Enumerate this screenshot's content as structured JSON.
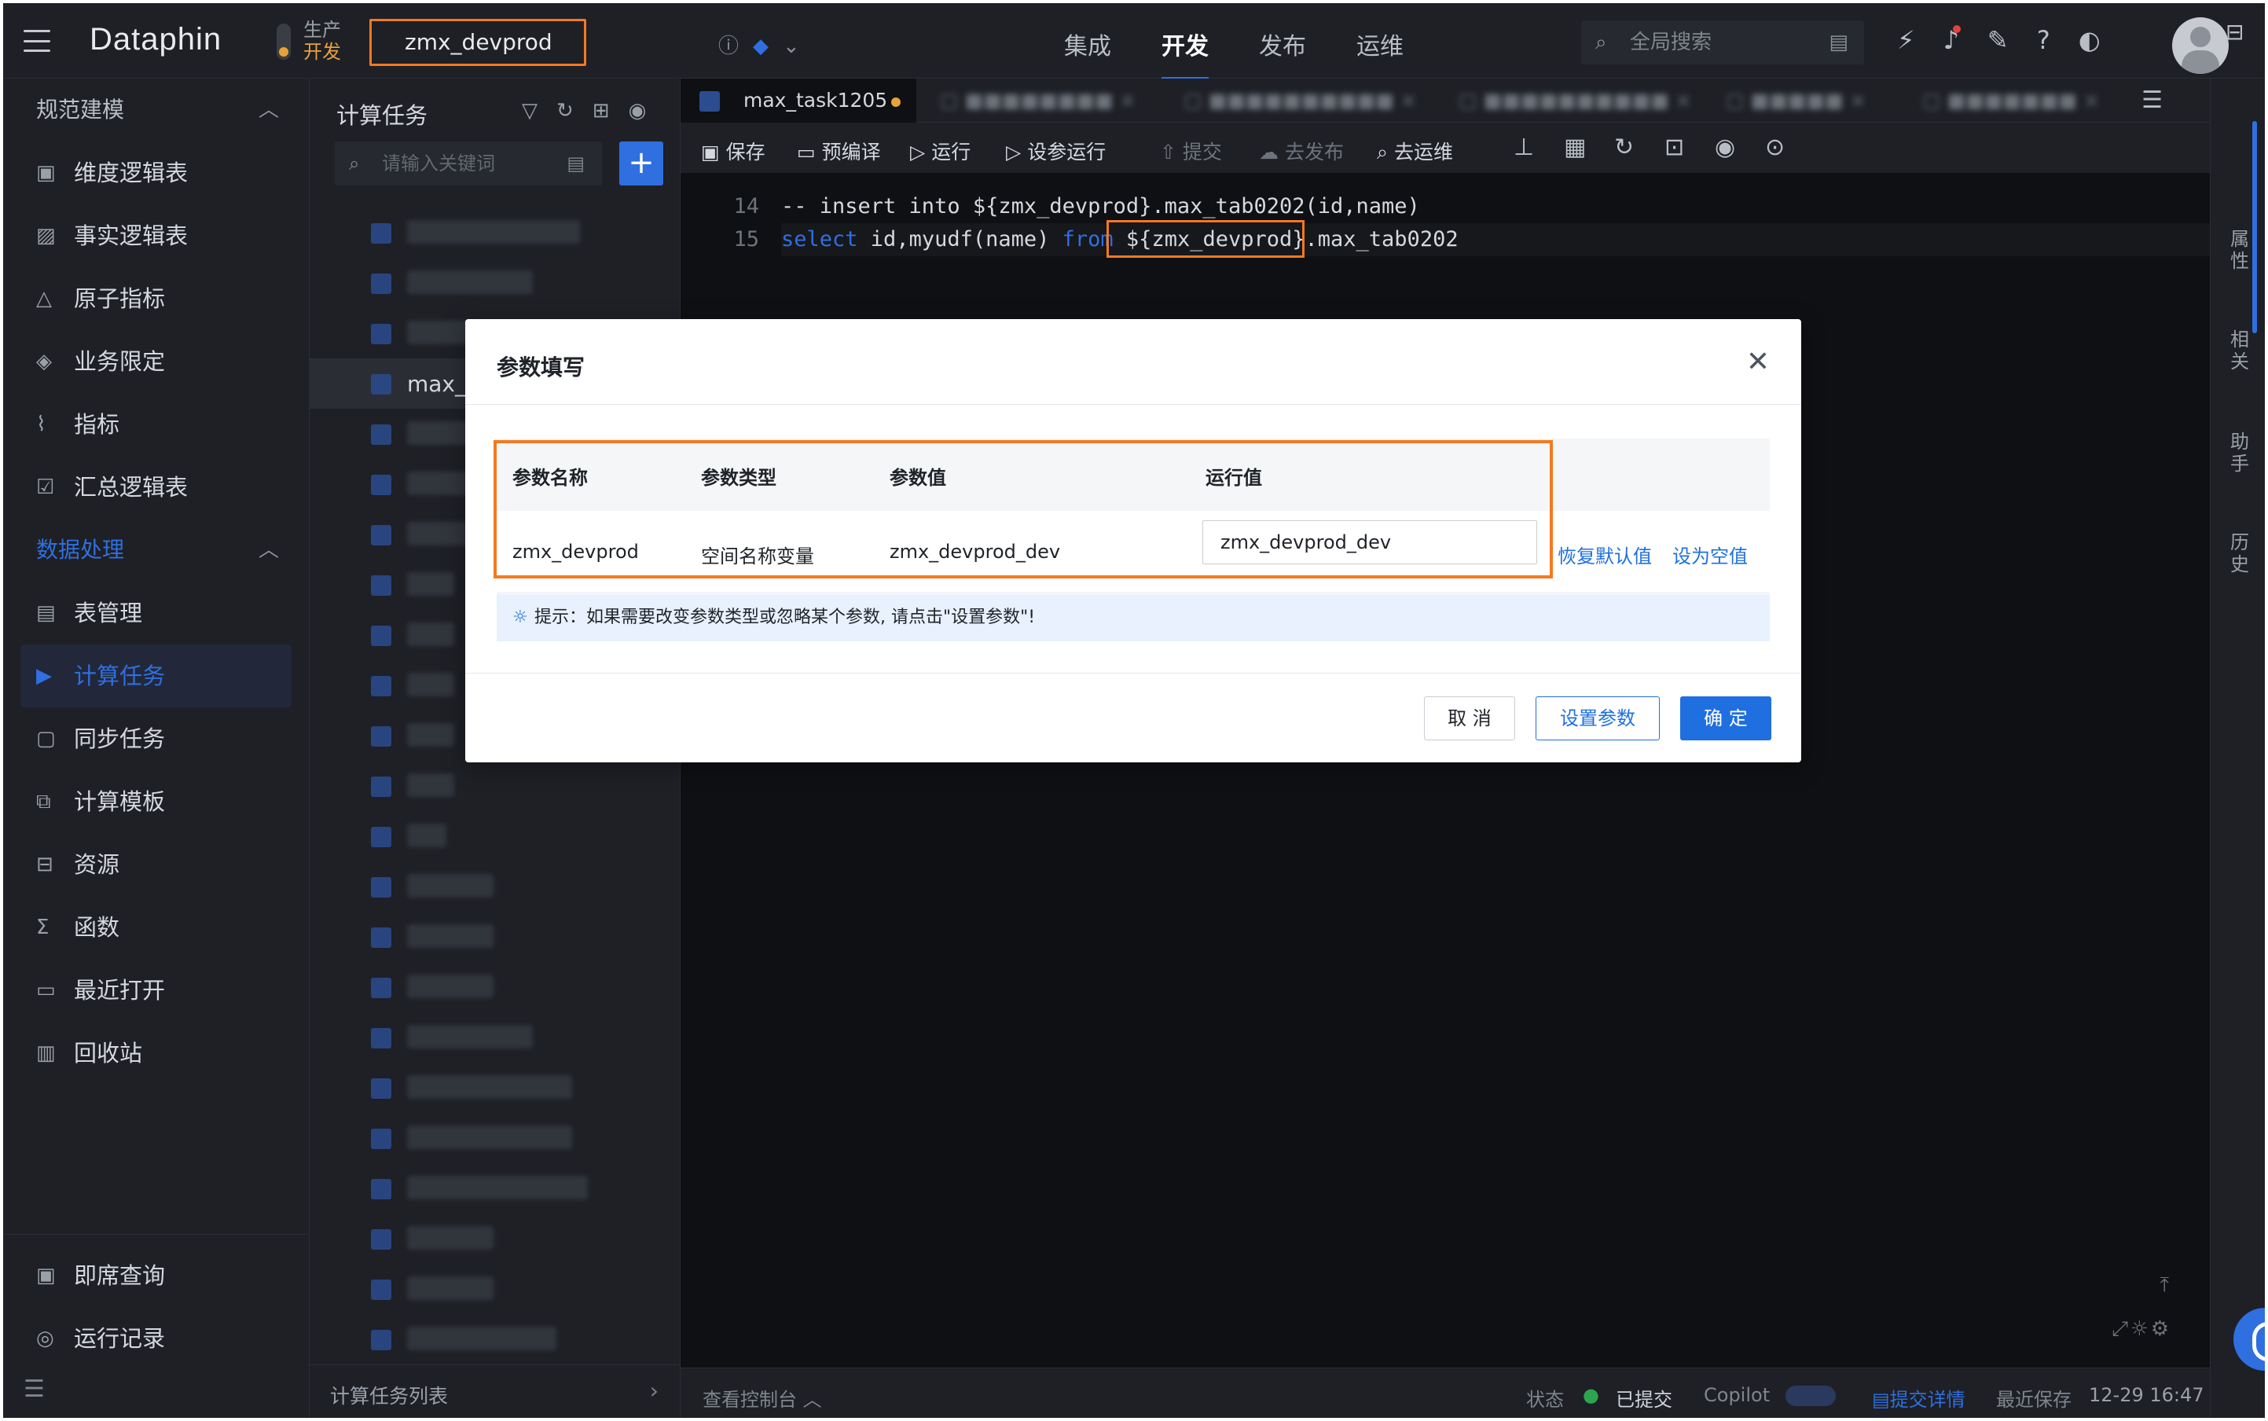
{
  "app": {
    "logo": "Dataphin"
  },
  "env": {
    "top": "生产",
    "bottom": "开发",
    "workspace": "zmx_devprod"
  },
  "nav": [
    "集成",
    "开发",
    "发布",
    "运维"
  ],
  "nav_active": "开发",
  "search": {
    "placeholder": "全局搜索"
  },
  "sidebar": {
    "group1": "规范建模",
    "items1": [
      "维度逻辑表",
      "事实逻辑表",
      "原子指标",
      "业务限定",
      "指标",
      "汇总逻辑表"
    ],
    "group2": "数据处理",
    "items2": [
      "表管理",
      "计算任务",
      "同步任务",
      "计算模板",
      "资源",
      "函数",
      "最近打开",
      "回收站"
    ],
    "bottom": [
      "即席查询",
      "运行记录"
    ]
  },
  "taskpanel": {
    "title": "计算任务",
    "search_placeholder": "请输入关键词",
    "selected_item": "max_t",
    "footer": "计算任务列表"
  },
  "editor": {
    "tab_active": "max_task1205",
    "toolbar": [
      "保存",
      "预编译",
      "运行",
      "设参运行",
      "提交",
      "去发布",
      "去运维"
    ],
    "lines": [
      {
        "no": "14",
        "text": "-- insert into ${zmx_devprod}.max_tab0202(id,name)"
      },
      {
        "no": "15",
        "kw1": "select",
        "mid": " id,myudf(name) ",
        "kw2": "from",
        "param": " ${zmx_devprod}",
        "rest": ".max_tab0202"
      }
    ],
    "footer": {
      "console": "查看控制台",
      "status_label": "状态",
      "status_value": "已提交",
      "copilot": "Copilot",
      "details": "提交详情",
      "last_save_label": "最近保存",
      "last_save_time": "12-29 16:47"
    }
  },
  "rail": [
    "属性",
    "相关",
    "助手",
    "历史"
  ],
  "dialog": {
    "title": "参数填写",
    "headers": [
      "参数名称",
      "参数类型",
      "参数值",
      "运行值"
    ],
    "row": {
      "name": "zmx_devprod",
      "type": "空间名称变量",
      "value": "zmx_devprod_dev",
      "run_value": "zmx_devprod_dev"
    },
    "links": [
      "恢复默认值",
      "设为空值"
    ],
    "hint": "提示：如果需要改变参数类型或忽略某个参数, 请点击\"设置参数\"!",
    "buttons": {
      "cancel": "取 消",
      "set": "设置参数",
      "ok": "确 定"
    }
  },
  "colors": {
    "accent": "#2f6fe0",
    "highlight": "#f47920",
    "env_dev": "#e9a23b"
  }
}
